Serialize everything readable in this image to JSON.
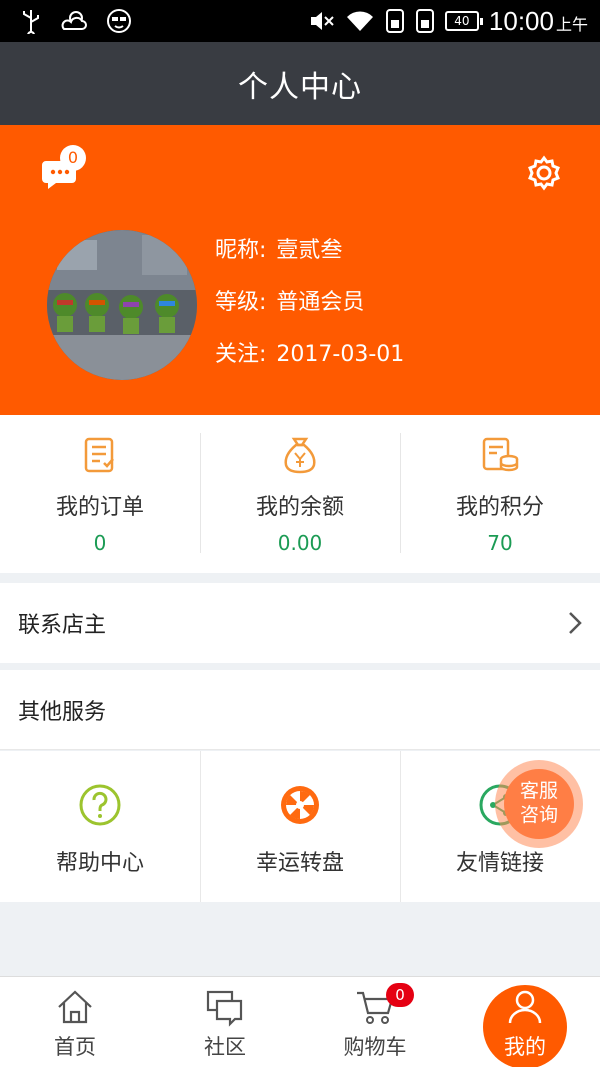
{
  "status_bar": {
    "time": "10:00",
    "ampm": "上午",
    "battery": "40"
  },
  "title": "个人中心",
  "header": {
    "message_count": "0"
  },
  "profile": {
    "nickname_label": "昵称:",
    "nickname": "壹贰叁",
    "level_label": "等级:",
    "level": "普通会员",
    "follow_label": "关注:",
    "follow_date": "2017-03-01"
  },
  "stats": [
    {
      "label": "我的订单",
      "value": "0",
      "icon": "order-list-icon"
    },
    {
      "label": "我的余额",
      "value": "0.00",
      "icon": "money-bag-icon"
    },
    {
      "label": "我的积分",
      "value": "70",
      "icon": "points-icon"
    }
  ],
  "contact": {
    "label": "联系店主"
  },
  "services_header": "其他服务",
  "services": [
    {
      "label": "帮助中心",
      "icon": "help-icon"
    },
    {
      "label": "幸运转盘",
      "icon": "wheel-icon"
    },
    {
      "label": "友情链接",
      "icon": "share-icon"
    }
  ],
  "consult": {
    "line1": "客服",
    "line2": "咨询"
  },
  "tabs": [
    {
      "label": "首页",
      "icon": "home-icon"
    },
    {
      "label": "社区",
      "icon": "community-icon"
    },
    {
      "label": "购物车",
      "icon": "cart-icon"
    },
    {
      "label": "我的",
      "icon": "user-icon"
    }
  ],
  "cart_count": "0",
  "colors": {
    "accent": "#ff5a00",
    "title_bar": "#393c42",
    "value_green": "#1b9b54",
    "badge_red": "#e50012"
  }
}
